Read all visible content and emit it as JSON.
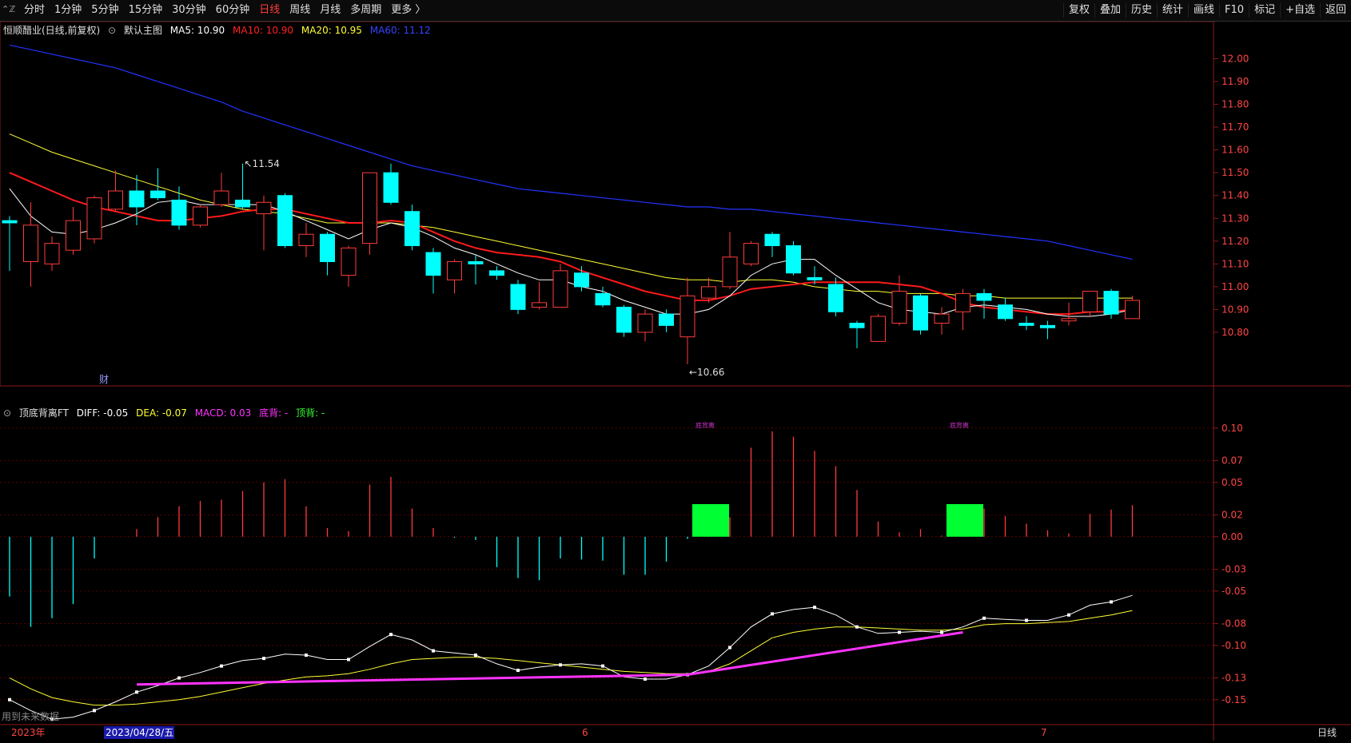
{
  "toolbar": {
    "left_icon": "⌃ℤ",
    "periods": [
      "分时",
      "1分钟",
      "5分钟",
      "15分钟",
      "30分钟",
      "60分钟",
      "日线",
      "周线",
      "月线",
      "多周期",
      "更多 〉"
    ],
    "active_period": 6,
    "tools": [
      "复权",
      "叠加",
      "历史",
      "统计",
      "画线",
      "F10",
      "标记",
      "+自选",
      "返回"
    ]
  },
  "main_legend": {
    "stock": "恒顺醋业(日线,前复权)",
    "chart_name": "默认主图",
    "ma5_label": "MA5: 10.90",
    "ma10_label": "MA10: 10.90",
    "ma20_label": "MA20: 10.95",
    "ma60_label": "MA60: 11.12"
  },
  "sub_legend": {
    "name": "顶底背离FT",
    "diff": "DIFF: -0.05",
    "dea": "DEA: -0.07",
    "macd": "MACD: 0.03",
    "bottom": "底背: -",
    "top": "顶背: -"
  },
  "labels": {
    "high": "11.54",
    "low": "10.66",
    "cai": "财",
    "warning": "用到未来数据",
    "divergence": "底背离",
    "bottom_right": "日线"
  },
  "xaxis": {
    "year": "2023年",
    "date": "2023/04/28/五",
    "m6": "6",
    "m7": "7"
  },
  "colors": {
    "up": "#ff3b3b",
    "down": "#00ffff",
    "ma5": "#ffffff",
    "ma10": "#ff1a1a",
    "ma20": "#ffff33",
    "ma60": "#2233ff",
    "diff": "#ffffff",
    "dea": "#ffff33",
    "macd_line": "#ff33ff",
    "box": "#00ff33"
  },
  "chart_data": [
    {
      "type": "candlestick",
      "title": "恒顺醋业(日线,前复权)",
      "ylim": [
        10.6,
        12.1
      ],
      "yticks": [
        10.8,
        10.9,
        11.0,
        11.1,
        11.2,
        11.3,
        11.4,
        11.5,
        11.6,
        11.7,
        11.8,
        11.9,
        12.0
      ],
      "candles": [
        {
          "o": 11.29,
          "c": 11.28,
          "h": 11.31,
          "l": 11.07
        },
        {
          "o": 11.11,
          "c": 11.27,
          "h": 11.37,
          "l": 11.0
        },
        {
          "o": 11.1,
          "c": 11.19,
          "h": 11.22,
          "l": 11.07
        },
        {
          "o": 11.16,
          "c": 11.29,
          "h": 11.35,
          "l": 11.14
        },
        {
          "o": 11.21,
          "c": 11.39,
          "h": 11.4,
          "l": 11.19
        },
        {
          "o": 11.34,
          "c": 11.42,
          "h": 11.51,
          "l": 11.33
        },
        {
          "o": 11.42,
          "c": 11.35,
          "h": 11.49,
          "l": 11.27
        },
        {
          "o": 11.42,
          "c": 11.39,
          "h": 11.52,
          "l": 11.38
        },
        {
          "o": 11.38,
          "c": 11.27,
          "h": 11.44,
          "l": 11.25
        },
        {
          "o": 11.27,
          "c": 11.35,
          "h": 11.36,
          "l": 11.26
        },
        {
          "o": 11.36,
          "c": 11.42,
          "h": 11.5,
          "l": 11.35
        },
        {
          "o": 11.38,
          "c": 11.35,
          "h": 11.54,
          "l": 11.34
        },
        {
          "o": 11.32,
          "c": 11.37,
          "h": 11.4,
          "l": 11.16
        },
        {
          "o": 11.4,
          "c": 11.18,
          "h": 11.41,
          "l": 11.17
        },
        {
          "o": 11.18,
          "c": 11.23,
          "h": 11.28,
          "l": 11.13
        },
        {
          "o": 11.23,
          "c": 11.11,
          "h": 11.24,
          "l": 11.05
        },
        {
          "o": 11.05,
          "c": 11.17,
          "h": 11.18,
          "l": 11.0
        },
        {
          "o": 11.19,
          "c": 11.5,
          "h": 11.5,
          "l": 11.14
        },
        {
          "o": 11.5,
          "c": 11.37,
          "h": 11.54,
          "l": 11.36
        },
        {
          "o": 11.33,
          "c": 11.18,
          "h": 11.36,
          "l": 11.16
        },
        {
          "o": 11.15,
          "c": 11.05,
          "h": 11.17,
          "l": 10.97
        },
        {
          "o": 11.03,
          "c": 11.11,
          "h": 11.12,
          "l": 10.97
        },
        {
          "o": 11.11,
          "c": 11.1,
          "h": 11.14,
          "l": 11.01
        },
        {
          "o": 11.07,
          "c": 11.05,
          "h": 11.09,
          "l": 11.03
        },
        {
          "o": 11.01,
          "c": 10.9,
          "h": 11.03,
          "l": 10.88
        },
        {
          "o": 10.91,
          "c": 10.93,
          "h": 11.02,
          "l": 10.9
        },
        {
          "o": 10.91,
          "c": 11.07,
          "h": 11.1,
          "l": 10.91
        },
        {
          "o": 11.06,
          "c": 11.0,
          "h": 11.09,
          "l": 10.98
        },
        {
          "o": 10.97,
          "c": 10.92,
          "h": 11.0,
          "l": 10.91
        },
        {
          "o": 10.91,
          "c": 10.8,
          "h": 10.92,
          "l": 10.78
        },
        {
          "o": 10.8,
          "c": 10.88,
          "h": 10.9,
          "l": 10.76
        },
        {
          "o": 10.88,
          "c": 10.83,
          "h": 10.9,
          "l": 10.8
        },
        {
          "o": 10.78,
          "c": 10.96,
          "h": 11.04,
          "l": 10.66
        },
        {
          "o": 10.95,
          "c": 11.0,
          "h": 11.04,
          "l": 10.93
        },
        {
          "o": 11.0,
          "c": 11.13,
          "h": 11.24,
          "l": 10.99
        },
        {
          "o": 11.1,
          "c": 11.19,
          "h": 11.2,
          "l": 11.09
        },
        {
          "o": 11.23,
          "c": 11.18,
          "h": 11.24,
          "l": 11.13
        },
        {
          "o": 11.18,
          "c": 11.06,
          "h": 11.2,
          "l": 11.05
        },
        {
          "o": 11.04,
          "c": 11.03,
          "h": 11.09,
          "l": 11.01
        },
        {
          "o": 11.01,
          "c": 10.89,
          "h": 11.04,
          "l": 10.87
        },
        {
          "o": 10.84,
          "c": 10.82,
          "h": 10.85,
          "l": 10.73
        },
        {
          "o": 10.76,
          "c": 10.87,
          "h": 10.88,
          "l": 10.76
        },
        {
          "o": 10.84,
          "c": 10.98,
          "h": 11.05,
          "l": 10.83
        },
        {
          "o": 10.96,
          "c": 10.81,
          "h": 10.97,
          "l": 10.79
        },
        {
          "o": 10.84,
          "c": 10.88,
          "h": 10.91,
          "l": 10.79
        },
        {
          "o": 10.89,
          "c": 10.97,
          "h": 10.99,
          "l": 10.81
        },
        {
          "o": 10.97,
          "c": 10.94,
          "h": 10.99,
          "l": 10.86
        },
        {
          "o": 10.92,
          "c": 10.86,
          "h": 10.95,
          "l": 10.85
        },
        {
          "o": 10.84,
          "c": 10.83,
          "h": 10.87,
          "l": 10.81
        },
        {
          "o": 10.83,
          "c": 10.82,
          "h": 10.85,
          "l": 10.77
        },
        {
          "o": 10.85,
          "c": 10.86,
          "h": 10.93,
          "l": 10.83
        },
        {
          "o": 10.89,
          "c": 10.98,
          "h": 10.98,
          "l": 10.87
        },
        {
          "o": 10.98,
          "c": 10.88,
          "h": 10.99,
          "l": 10.86
        },
        {
          "o": 10.86,
          "c": 10.94,
          "h": 10.96,
          "l": 10.86
        }
      ],
      "ma5": [
        11.43,
        11.31,
        11.24,
        11.23,
        11.25,
        11.28,
        11.32,
        11.37,
        11.38,
        11.36,
        11.36,
        11.36,
        11.36,
        11.33,
        11.29,
        11.25,
        11.21,
        11.25,
        11.28,
        11.26,
        11.22,
        11.17,
        11.14,
        11.1,
        11.06,
        11.03,
        11.03,
        11.0,
        10.98,
        10.94,
        10.91,
        10.88,
        10.88,
        10.9,
        10.96,
        11.05,
        11.1,
        11.12,
        11.12,
        11.05,
        10.99,
        10.93,
        10.9,
        10.89,
        10.88,
        10.91,
        10.92,
        10.91,
        10.9,
        10.88,
        10.87,
        10.87,
        10.88,
        10.9
      ],
      "ma10": [
        11.5,
        11.46,
        11.42,
        11.38,
        11.35,
        11.33,
        11.31,
        11.29,
        11.29,
        11.3,
        11.31,
        11.33,
        11.34,
        11.34,
        11.32,
        11.3,
        11.28,
        11.28,
        11.29,
        11.28,
        11.24,
        11.2,
        11.17,
        11.15,
        11.14,
        11.13,
        11.11,
        11.07,
        11.04,
        11.01,
        10.98,
        10.96,
        10.94,
        10.94,
        10.96,
        10.99,
        11.0,
        11.01,
        11.02,
        11.02,
        11.02,
        11.02,
        11.01,
        11.0,
        10.97,
        10.93,
        10.91,
        10.9,
        10.89,
        10.88,
        10.88,
        10.89,
        10.89,
        10.9
      ],
      "ma20": [
        11.67,
        11.63,
        11.59,
        11.56,
        11.53,
        11.5,
        11.47,
        11.44,
        11.41,
        11.38,
        11.36,
        11.34,
        11.33,
        11.32,
        11.3,
        11.28,
        11.28,
        11.28,
        11.28,
        11.27,
        11.26,
        11.24,
        11.22,
        11.2,
        11.18,
        11.16,
        11.14,
        11.12,
        11.1,
        11.08,
        11.06,
        11.04,
        11.03,
        11.03,
        11.02,
        11.03,
        11.03,
        11.02,
        11.0,
        10.99,
        10.98,
        10.98,
        10.97,
        10.97,
        10.97,
        10.96,
        10.96,
        10.95,
        10.95,
        10.95,
        10.95,
        10.95,
        10.95,
        10.95
      ],
      "ma60": [
        12.06,
        12.04,
        12.02,
        12.0,
        11.98,
        11.96,
        11.93,
        11.9,
        11.87,
        11.84,
        11.81,
        11.77,
        11.74,
        11.71,
        11.68,
        11.65,
        11.62,
        11.59,
        11.56,
        11.53,
        11.51,
        11.49,
        11.47,
        11.45,
        11.43,
        11.42,
        11.41,
        11.4,
        11.39,
        11.38,
        11.37,
        11.36,
        11.35,
        11.35,
        11.34,
        11.34,
        11.33,
        11.32,
        11.31,
        11.3,
        11.29,
        11.28,
        11.27,
        11.26,
        11.25,
        11.24,
        11.23,
        11.22,
        11.21,
        11.2,
        11.18,
        11.16,
        11.14,
        11.12
      ]
    },
    {
      "type": "bar",
      "title": "顶底背离FT",
      "ylim": [
        -0.17,
        0.13
      ],
      "yticks": [
        0.1,
        0.07,
        0.05,
        0.02,
        0.0,
        -0.03,
        -0.05,
        -0.08,
        -0.1,
        -0.13,
        -0.15
      ],
      "macd": [
        -0.055,
        -0.083,
        -0.075,
        -0.062,
        -0.02,
        0.0,
        0.007,
        0.018,
        0.028,
        0.033,
        0.034,
        0.042,
        0.05,
        0.053,
        0.028,
        0.008,
        0.005,
        0.048,
        0.055,
        0.026,
        0.008,
        -0.001,
        -0.003,
        -0.028,
        -0.038,
        -0.04,
        -0.02,
        -0.021,
        -0.022,
        -0.035,
        -0.035,
        -0.023,
        -0.002,
        0.025,
        0.018,
        0.082,
        0.097,
        0.092,
        0.079,
        0.065,
        0.043,
        0.014,
        0.004,
        0.007,
        0.001,
        0.015,
        0.026,
        0.019,
        0.012,
        0.006,
        0.003,
        0.021,
        0.025,
        0.029
      ],
      "diff": [
        -0.15,
        -0.16,
        -0.168,
        -0.166,
        -0.16,
        -0.152,
        -0.143,
        -0.137,
        -0.13,
        -0.125,
        -0.119,
        -0.114,
        -0.112,
        -0.108,
        -0.109,
        -0.113,
        -0.113,
        -0.101,
        -0.09,
        -0.095,
        -0.105,
        -0.107,
        -0.109,
        -0.117,
        -0.123,
        -0.12,
        -0.118,
        -0.117,
        -0.119,
        -0.129,
        -0.131,
        -0.131,
        -0.127,
        -0.119,
        -0.102,
        -0.083,
        -0.071,
        -0.067,
        -0.065,
        -0.072,
        -0.083,
        -0.089,
        -0.088,
        -0.087,
        -0.088,
        -0.083,
        -0.075,
        -0.076,
        -0.077,
        -0.077,
        -0.072,
        -0.063,
        -0.06,
        -0.054
      ],
      "dea": [
        -0.13,
        -0.14,
        -0.148,
        -0.152,
        -0.155,
        -0.155,
        -0.154,
        -0.152,
        -0.15,
        -0.147,
        -0.143,
        -0.139,
        -0.135,
        -0.132,
        -0.129,
        -0.128,
        -0.126,
        -0.122,
        -0.117,
        -0.113,
        -0.112,
        -0.111,
        -0.111,
        -0.112,
        -0.114,
        -0.116,
        -0.118,
        -0.12,
        -0.122,
        -0.124,
        -0.125,
        -0.126,
        -0.126,
        -0.124,
        -0.117,
        -0.105,
        -0.093,
        -0.088,
        -0.085,
        -0.083,
        -0.083,
        -0.084,
        -0.085,
        -0.086,
        -0.086,
        -0.085,
        -0.081,
        -0.08,
        -0.08,
        -0.079,
        -0.078,
        -0.075,
        -0.072,
        -0.068
      ],
      "divergence_lines": [
        [
          6,
          -0.136,
          32,
          -0.127
        ],
        [
          32,
          -0.127,
          45,
          -0.088
        ]
      ],
      "boxes": [
        [
          32,
          0.03
        ],
        [
          44,
          0.03
        ]
      ]
    }
  ]
}
